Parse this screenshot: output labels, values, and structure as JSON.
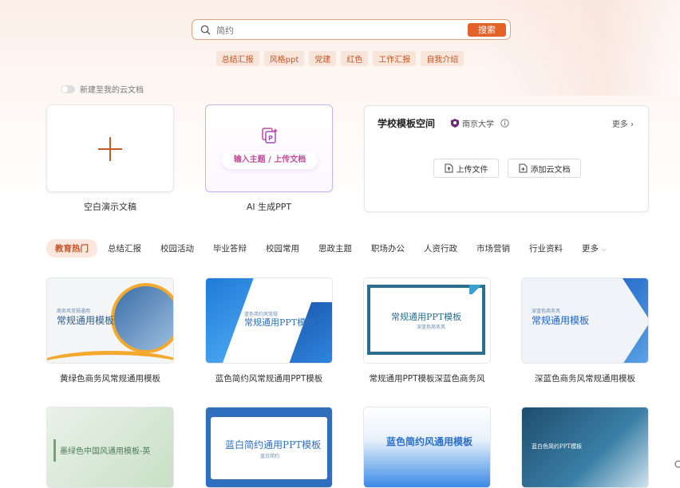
{
  "search": {
    "placeholder": "简约",
    "button_label": "搜索",
    "hot_tags": [
      "总结汇报",
      "风格ppt",
      "党建",
      "红色",
      "工作汇报",
      "自我介绍"
    ]
  },
  "toggle": {
    "label": "新建至我的云文档"
  },
  "create_cards": {
    "blank_label": "空白演示文稿",
    "ai_pill_label": "输入主题 / 上传文档",
    "ai_label": "AI 生成PPT"
  },
  "school_space": {
    "title": "学校模板空间",
    "university": "南京大学",
    "more": "更多",
    "upload_label": "上传文件",
    "add_cloud_label": "添加云文档"
  },
  "categories": [
    "教育热门",
    "总结汇报",
    "校园活动",
    "毕业答辩",
    "校园常用",
    "思政主题",
    "职场办公",
    "人资行政",
    "市场营销",
    "行业资料",
    "更多"
  ],
  "templates": [
    {
      "caption": "黄绿色商务风常规通用模板",
      "thumb_title": "常规通用模板",
      "thumb_sub": "商务风常规通用"
    },
    {
      "caption": "蓝色简约风常规通用PPT模板",
      "thumb_title": "常规通用PPT模板",
      "thumb_sub": "蓝色简约风常规"
    },
    {
      "caption": "常规通用PPT模板深蓝色商务风",
      "thumb_title": "常规通用PPT模板",
      "thumb_sub": "深蓝色商务风"
    },
    {
      "caption": "深蓝色商务风常规通用模板",
      "thumb_title": "常规通用模板",
      "thumb_sub": "深蓝色商务风"
    },
    {
      "caption": "",
      "thumb_title": "墨绿色中国风通用模板-英"
    },
    {
      "caption": "",
      "thumb_title": "蓝白简约通用PPT模板",
      "thumb_sub": "蓝白简约"
    },
    {
      "caption": "",
      "thumb_title": "蓝色简约风通用模板"
    },
    {
      "caption": "",
      "thumb_title": "蓝白色简约PPT模板"
    }
  ],
  "colors": {
    "accent": "#e2622a",
    "accent_text": "#c0552a",
    "ai_accent": "#c24c9a"
  }
}
